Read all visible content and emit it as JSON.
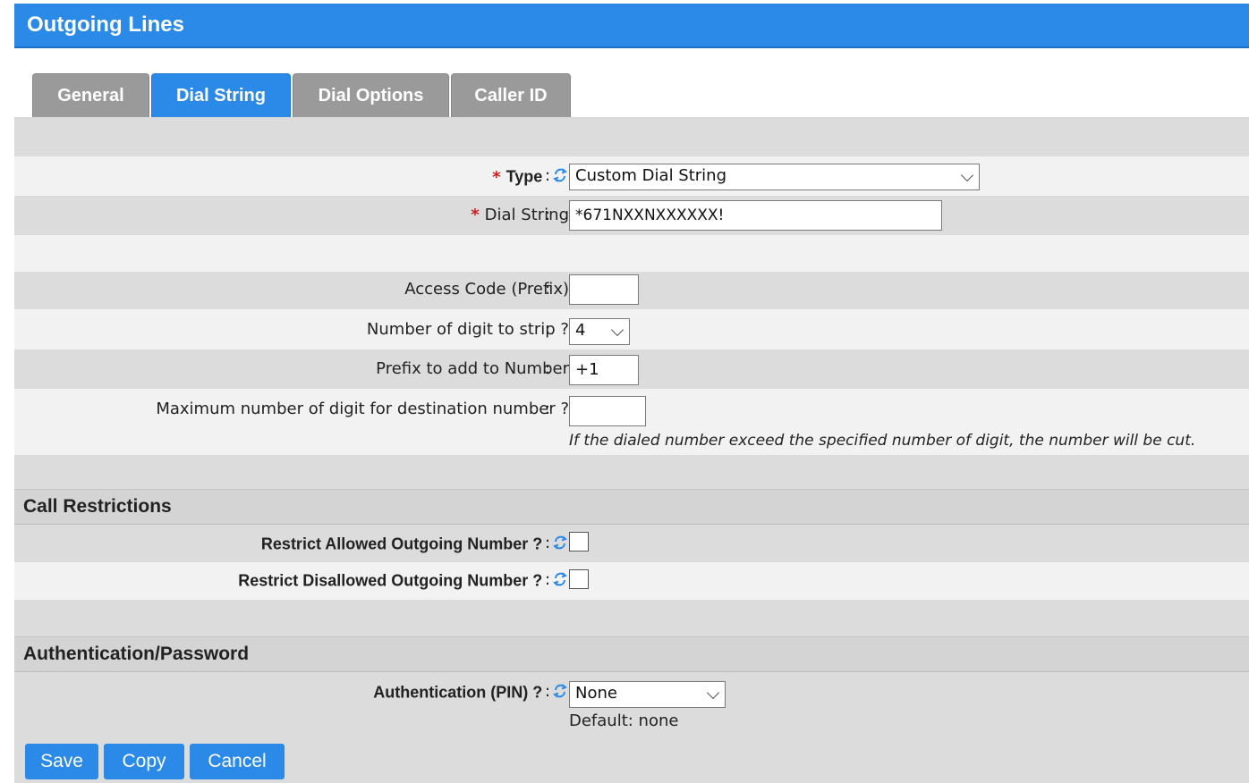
{
  "header": {
    "title": "Outgoing Lines"
  },
  "tabs": [
    {
      "label": "General"
    },
    {
      "label": "Dial String"
    },
    {
      "label": "Dial Options"
    },
    {
      "label": "Caller ID"
    }
  ],
  "form": {
    "type": {
      "label": "Type",
      "value": "Custom Dial String"
    },
    "dial_string": {
      "label": "Dial String",
      "value": "*671NXXNXXXXXX!"
    },
    "access_code": {
      "label": "Access Code (Prefix)",
      "value": ""
    },
    "strip_digits": {
      "label": "Number of digit to strip ?",
      "value": "4"
    },
    "prefix_add": {
      "label": "Prefix to add to Number",
      "value": "+1"
    },
    "max_digits": {
      "label": "Maximum number of digit for destination number ?",
      "value": "",
      "hint": "If the dialed number exceed the specified number of digit, the number will be cut."
    }
  },
  "call_restrictions": {
    "title": "Call Restrictions",
    "restrict_allowed": {
      "label": "Restrict Allowed Outgoing Number ?",
      "checked": false
    },
    "restrict_disallowed": {
      "label": "Restrict Disallowed Outgoing Number ?",
      "checked": false
    }
  },
  "authentication": {
    "title": "Authentication/Password",
    "pin": {
      "label": "Authentication (PIN) ?",
      "value": "None",
      "default_text": "Default: none"
    }
  },
  "colon": ":",
  "required_mark": "*",
  "buttons": {
    "save": "Save",
    "copy": "Copy",
    "cancel": "Cancel"
  },
  "colors": {
    "accent": "#2b89e8",
    "required": "#d01c1c"
  }
}
